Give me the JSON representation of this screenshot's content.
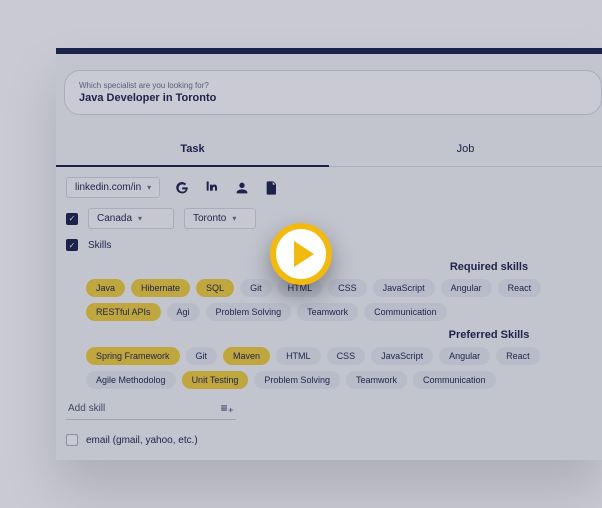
{
  "search": {
    "hint": "Which specialist are you looking for?",
    "query": "Java Developer in Toronto"
  },
  "tabs": {
    "task": "Task",
    "job": "Job"
  },
  "source": {
    "select": "linkedin.com/in"
  },
  "location": {
    "country": "Canada",
    "city": "Toronto"
  },
  "skills_label": "Skills",
  "section": {
    "required": "Required skills",
    "preferred": "Preferred Skills"
  },
  "required": [
    {
      "t": "Java",
      "s": true
    },
    {
      "t": "Hibernate",
      "s": true
    },
    {
      "t": "SQL",
      "s": true
    },
    {
      "t": "Git",
      "s": false
    },
    {
      "t": "HTML",
      "s": false
    },
    {
      "t": "CSS",
      "s": false
    },
    {
      "t": "JavaScript",
      "s": false
    },
    {
      "t": "Angular",
      "s": false
    },
    {
      "t": "React",
      "s": false
    },
    {
      "t": "RESTful APIs",
      "s": true
    },
    {
      "t": "Agi",
      "s": false
    },
    {
      "t": "Problem Solving",
      "s": false
    },
    {
      "t": "Teamwork",
      "s": false
    },
    {
      "t": "Communication",
      "s": false
    }
  ],
  "preferred": [
    {
      "t": "Spring Framework",
      "s": true
    },
    {
      "t": "Git",
      "s": false
    },
    {
      "t": "Maven",
      "s": true
    },
    {
      "t": "HTML",
      "s": false
    },
    {
      "t": "CSS",
      "s": false
    },
    {
      "t": "JavaScript",
      "s": false
    },
    {
      "t": "Angular",
      "s": false
    },
    {
      "t": "React",
      "s": false
    },
    {
      "t": "Agile Methodolog",
      "s": false
    },
    {
      "t": "Unit Testing",
      "s": true
    },
    {
      "t": "Problem Solving",
      "s": false
    },
    {
      "t": "Teamwork",
      "s": false
    },
    {
      "t": "Communication",
      "s": false
    }
  ],
  "addskill": "Add skill",
  "email_label": "email (gmail, yahoo, etc.)"
}
